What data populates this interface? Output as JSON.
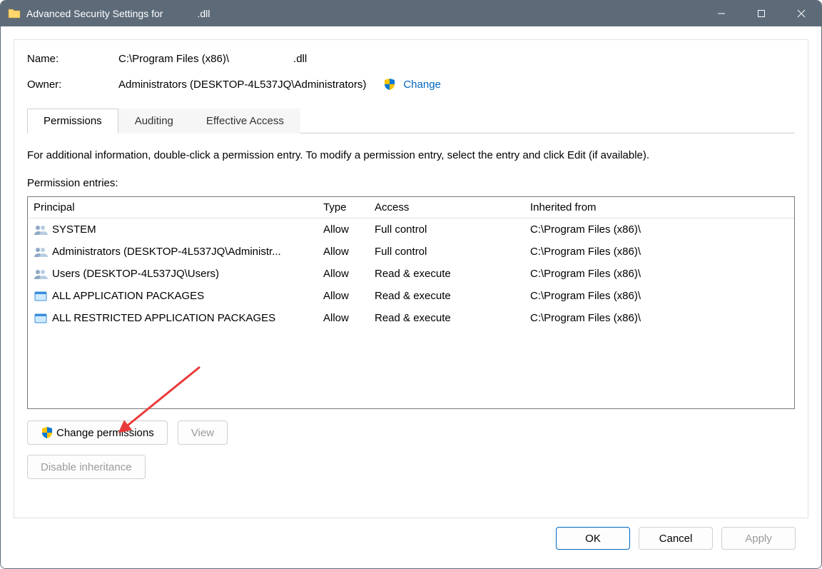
{
  "title_prefix": "Advanced Security Settings for",
  "title_file": ".dll",
  "name_label": "Name:",
  "name_path": "C:\\Program Files (x86)\\",
  "name_ext": ".dll",
  "owner_label": "Owner:",
  "owner_value": "Administrators (DESKTOP-4L537JQ\\Administrators)",
  "change_link": "Change",
  "tabs": {
    "permissions": "Permissions",
    "auditing": "Auditing",
    "effective": "Effective Access"
  },
  "tab_desc": "For additional information, double-click a permission entry. To modify a permission entry, select the entry and click Edit (if available).",
  "entries_label": "Permission entries:",
  "columns": {
    "principal": "Principal",
    "type": "Type",
    "access": "Access",
    "inherited": "Inherited from"
  },
  "rows": [
    {
      "icon": "group",
      "principal": "SYSTEM",
      "type": "Allow",
      "access": "Full control",
      "inherited": "C:\\Program Files (x86)\\"
    },
    {
      "icon": "group",
      "principal": "Administrators (DESKTOP-4L537JQ\\Administr...",
      "type": "Allow",
      "access": "Full control",
      "inherited": "C:\\Program Files (x86)\\"
    },
    {
      "icon": "group",
      "principal": "Users (DESKTOP-4L537JQ\\Users)",
      "type": "Allow",
      "access": "Read & execute",
      "inherited": "C:\\Program Files (x86)\\"
    },
    {
      "icon": "package",
      "principal": "ALL APPLICATION PACKAGES",
      "type": "Allow",
      "access": "Read & execute",
      "inherited": "C:\\Program Files (x86)\\"
    },
    {
      "icon": "package",
      "principal": "ALL RESTRICTED APPLICATION PACKAGES",
      "type": "Allow",
      "access": "Read & execute",
      "inherited": "C:\\Program Files (x86)\\"
    }
  ],
  "buttons": {
    "change_permissions": "Change permissions",
    "view": "View",
    "disable_inheritance": "Disable inheritance",
    "ok": "OK",
    "cancel": "Cancel",
    "apply": "Apply"
  }
}
